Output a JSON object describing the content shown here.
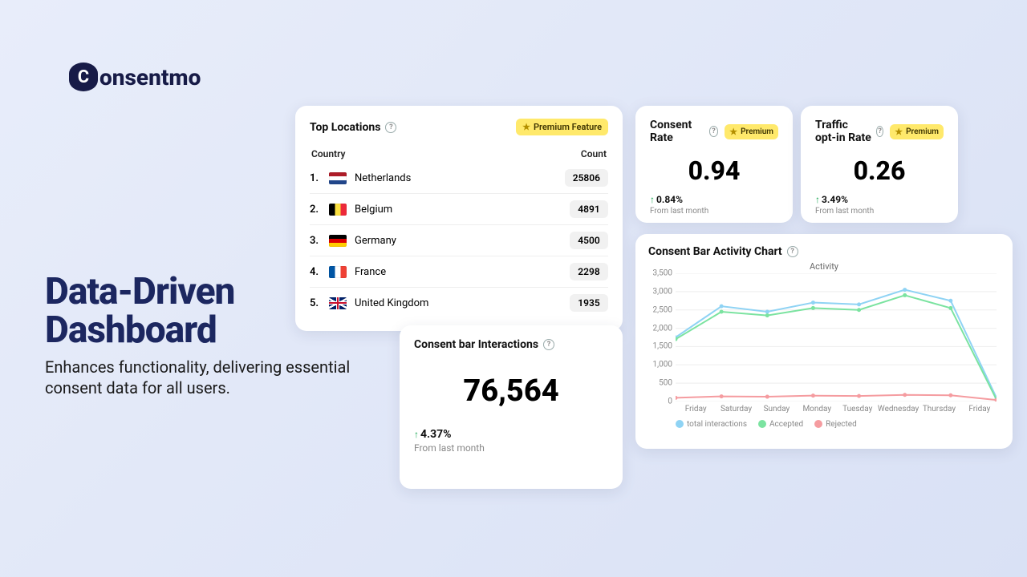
{
  "brand": {
    "name": "onsentmo",
    "mark": "C"
  },
  "headline": {
    "title": "Data-Driven Dashboard",
    "subtitle": "Enhances functionality, delivering essential consent data for all users."
  },
  "top_locations": {
    "title": "Top Locations",
    "premium_label": "Premium Feature",
    "col_country": "Country",
    "col_count": "Count",
    "rows": [
      {
        "rank": "1.",
        "flag": "flag-nl",
        "name": "Netherlands",
        "count": "25806"
      },
      {
        "rank": "2.",
        "flag": "flag-be",
        "name": "Belgium",
        "count": "4891"
      },
      {
        "rank": "3.",
        "flag": "flag-de",
        "name": "Germany",
        "count": "4500"
      },
      {
        "rank": "4.",
        "flag": "flag-fr",
        "name": "France",
        "count": "2298"
      },
      {
        "rank": "5.",
        "flag": "flag-gb",
        "name": "United Kingdom",
        "count": "1935"
      }
    ]
  },
  "consent_rate": {
    "title": "Consent Rate",
    "premium_label": "Premium",
    "value": "0.94",
    "delta": "0.84%",
    "from": "From last month"
  },
  "traffic_rate": {
    "title": "Traffic opt-in Rate",
    "premium_label": "Premium",
    "value": "0.26",
    "delta": "3.49%",
    "from": "From last month"
  },
  "interactions": {
    "title": "Consent bar Interactions",
    "value": "76,564",
    "delta": "4.37%",
    "from": "From last month"
  },
  "activity": {
    "title": "Consent Bar Activity Chart",
    "subtitle": "Activity",
    "legend": {
      "total": "total interactions",
      "accepted": "Accepted",
      "rejected": "Rejected"
    },
    "colors": {
      "total": "#8fd3f4",
      "accepted": "#7be3a0",
      "rejected": "#f59ca0"
    }
  },
  "chart_data": {
    "type": "line",
    "title": "Activity",
    "xlabel": "",
    "ylabel": "",
    "ylim": [
      0,
      3500
    ],
    "y_ticks": [
      0,
      500,
      1000,
      1500,
      2000,
      2500,
      3000,
      3500
    ],
    "categories": [
      "Friday",
      "Saturday",
      "Sunday",
      "Monday",
      "Tuesday",
      "Wednesday",
      "Thursday",
      "Friday"
    ],
    "series": [
      {
        "name": "total interactions",
        "color": "#8fd3f4",
        "values": [
          1750,
          2600,
          2450,
          2700,
          2650,
          3050,
          2750,
          100
        ]
      },
      {
        "name": "Accepted",
        "color": "#7be3a0",
        "values": [
          1700,
          2450,
          2350,
          2550,
          2500,
          2900,
          2550,
          50
        ]
      },
      {
        "name": "Rejected",
        "color": "#f59ca0",
        "values": [
          100,
          140,
          130,
          160,
          150,
          180,
          170,
          40
        ]
      }
    ]
  }
}
